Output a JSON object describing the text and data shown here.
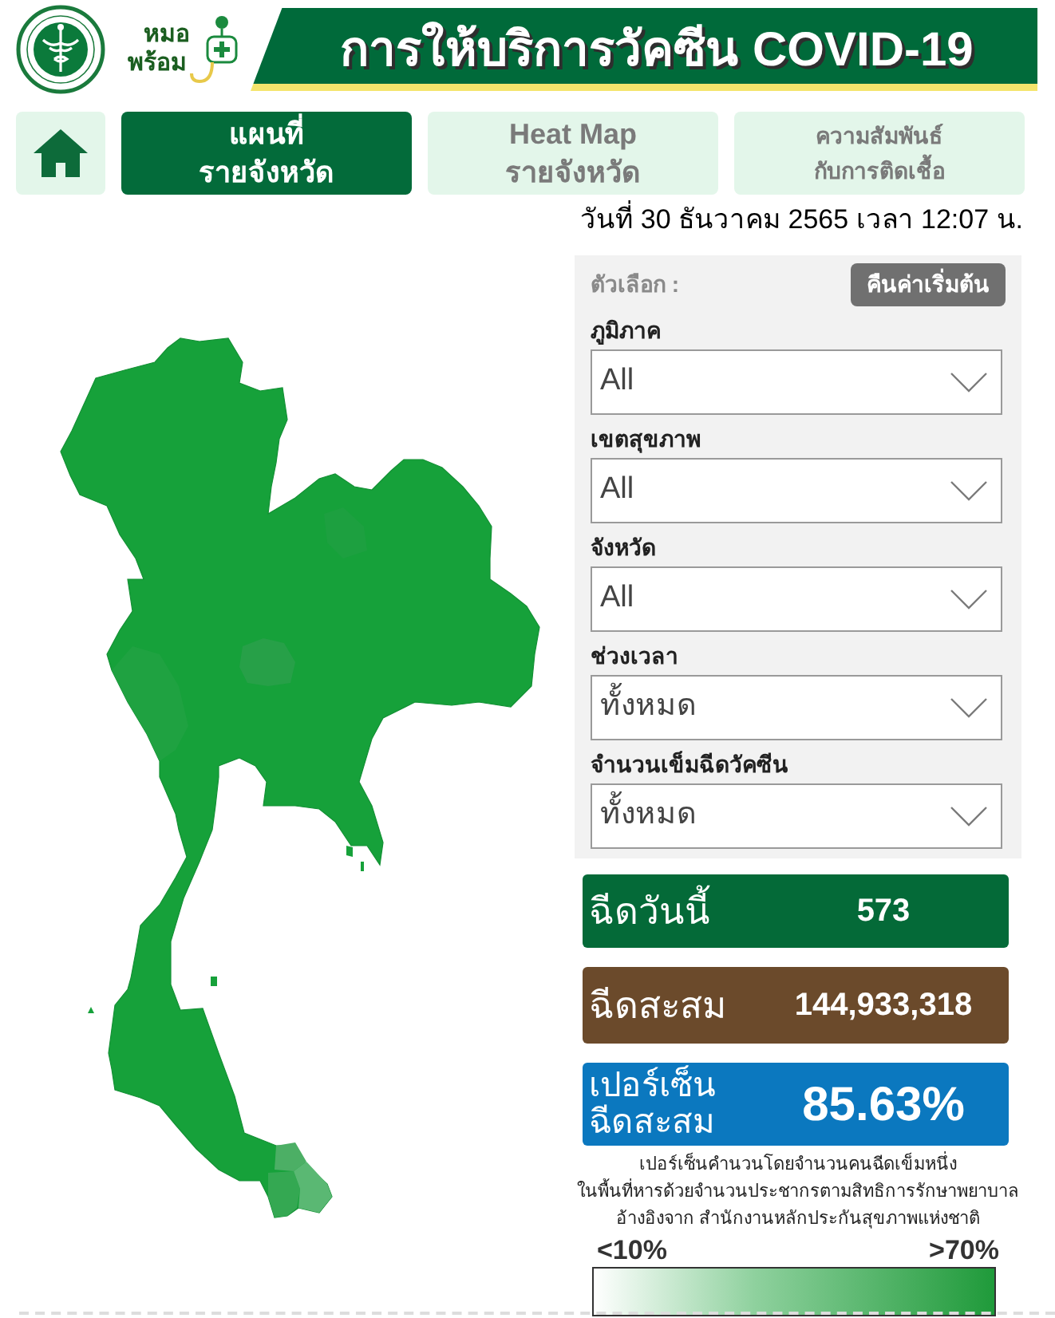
{
  "header": {
    "logo_text": [
      "หมอ",
      "พร้อม"
    ],
    "title": "การให้บริการวัคซีน COVID-19"
  },
  "nav": {
    "tabs": [
      {
        "label": "แผนที่\nรายจังหวัด",
        "selected": true
      },
      {
        "label": "Heat Map\nรายจังหวัด",
        "selected": false
      },
      {
        "label": "ความสัมพันธ์\nกับการติดเชื้อ",
        "selected": false
      }
    ]
  },
  "updated": "วันที่ 30 ธันวาคม 2565 เวลา 12:07 น.",
  "filters": {
    "title": "ตัวเลือก :",
    "reset_button": "คืนค่าเริ่มต้น",
    "fields": [
      {
        "label": "ภูมิภาค",
        "value": "All"
      },
      {
        "label": "เขตสุขภาพ",
        "value": "All"
      },
      {
        "label": "จังหวัด",
        "value": "All"
      },
      {
        "label": "ช่วงเวลา",
        "value": "ทั้งหมด"
      },
      {
        "label": "จำนวนเข็มฉีดวัคซีน",
        "value": "ทั้งหมด"
      }
    ]
  },
  "stats": [
    {
      "kind": "count",
      "label": "ฉีดวันนี้",
      "value": "573",
      "color": "#046a38"
    },
    {
      "kind": "count",
      "label": "ฉีดสะสม",
      "value": "144,933,318",
      "color": "#6b4a2b"
    },
    {
      "kind": "percent",
      "label": "เปอร์เซ็น\nฉีดสะสม",
      "value": "85.63%",
      "color": "#0b78bf"
    }
  ],
  "note": "เปอร์เซ็นคำนวนโดยจำนวนคนฉีดเข็มหนึ่ง\nในพื้นที่หารด้วยจำนวนประชากรตามสิทธิการรักษาพยาบาล\nอ้างอิงจาก สำนักงานหลักประกันสุขภาพแห่งชาติ",
  "legend": {
    "min_label": "<10%",
    "max_label": ">70%"
  }
}
